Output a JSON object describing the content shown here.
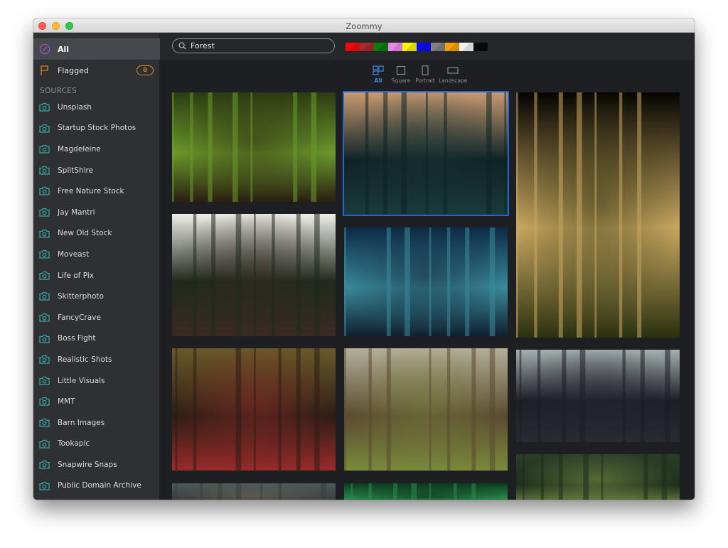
{
  "window": {
    "title": "Zoommy"
  },
  "sidebar": {
    "all_label": "All",
    "flagged_label": "Flagged",
    "flagged_count": "0",
    "sources_heading": "SOURCES",
    "sources": [
      {
        "label": "Unsplash"
      },
      {
        "label": "Startup Stock Photos"
      },
      {
        "label": "Magdeleine"
      },
      {
        "label": "SplitShire"
      },
      {
        "label": "Free Nature Stock"
      },
      {
        "label": "Jay Mantri"
      },
      {
        "label": "New Old Stock"
      },
      {
        "label": "Moveast"
      },
      {
        "label": "Life of Pix"
      },
      {
        "label": "Skitterphoto"
      },
      {
        "label": "FancyCrave"
      },
      {
        "label": "Boss Fight"
      },
      {
        "label": "Realistic Shots"
      },
      {
        "label": "Little Visuals"
      },
      {
        "label": "MMT"
      },
      {
        "label": "Barn Images"
      },
      {
        "label": "Tookapic"
      },
      {
        "label": "Snapwire Snaps"
      },
      {
        "label": "Public Domain Archive"
      }
    ]
  },
  "search": {
    "value": "Forest",
    "icon": "search-icon"
  },
  "color_filters": [
    {
      "name": "red",
      "color": "#f00a0a"
    },
    {
      "name": "brown",
      "color": "#a52a2a"
    },
    {
      "name": "green",
      "color": "#0a7d0a"
    },
    {
      "name": "violet",
      "color": "#ea88ea"
    },
    {
      "name": "yellow",
      "color": "#f5f500"
    },
    {
      "name": "blue",
      "color": "#0a0af5"
    },
    {
      "name": "gray",
      "color": "#808080"
    },
    {
      "name": "orange",
      "color": "#f5a000"
    },
    {
      "name": "white",
      "color": "#f2f2f2"
    },
    {
      "name": "black",
      "color": "#0a0a0a"
    }
  ],
  "orientation_filters": [
    {
      "label": "All",
      "icon": "all-orientations-icon",
      "active": true
    },
    {
      "label": "Square",
      "icon": "square-icon",
      "active": false
    },
    {
      "label": "Portrait",
      "icon": "portrait-icon",
      "active": false
    },
    {
      "label": "Landscape",
      "icon": "landscape-icon",
      "active": false
    }
  ],
  "photos": [
    {
      "name": "green-forest-ferns",
      "palette": [
        "#2c3a12",
        "#6a9a2a",
        "#2a1e12"
      ],
      "selected": false
    },
    {
      "name": "dusk-pine-treeline",
      "palette": [
        "#c89a70",
        "#0f2226",
        "#1a3a3a"
      ],
      "selected": true
    },
    {
      "name": "sunlit-tree-fog-night",
      "palette": [
        "#050402",
        "#c9a860",
        "#2a3010"
      ],
      "selected": false
    },
    {
      "name": "woman-facing-pines",
      "palette": [
        "#efedea",
        "#1f2a1c",
        "#3a2a22"
      ],
      "selected": false
    },
    {
      "name": "blue-glowing-forest",
      "palette": [
        "#0c2a45",
        "#3a8a9a",
        "#102030"
      ],
      "selected": false
    },
    {
      "name": "woman-red-scarf-woods",
      "palette": [
        "#6a5a2a",
        "#2c1e14",
        "#9a2a2a"
      ],
      "selected": false
    },
    {
      "name": "sunny-bare-trees",
      "palette": [
        "#b4b09a",
        "#5a4a32",
        "#7a8a3a"
      ],
      "selected": false
    },
    {
      "name": "misty-bare-forest",
      "palette": [
        "#a4b0b0",
        "#1e1e26",
        "#2a2a34"
      ],
      "selected": false
    },
    {
      "name": "hill-pine-forest",
      "palette": [
        "#2a3e26",
        "#1e2e1c",
        "#8aa050"
      ],
      "selected": false
    },
    {
      "name": "person-hair-closeup",
      "palette": [
        "#4a5a5a",
        "#3a3e3e",
        "#7a6a5a"
      ],
      "selected": false
    },
    {
      "name": "green-blurred-trunks",
      "palette": [
        "#0a3a1e",
        "#2a8a4a",
        "#0a1e10"
      ],
      "selected": false
    }
  ]
}
